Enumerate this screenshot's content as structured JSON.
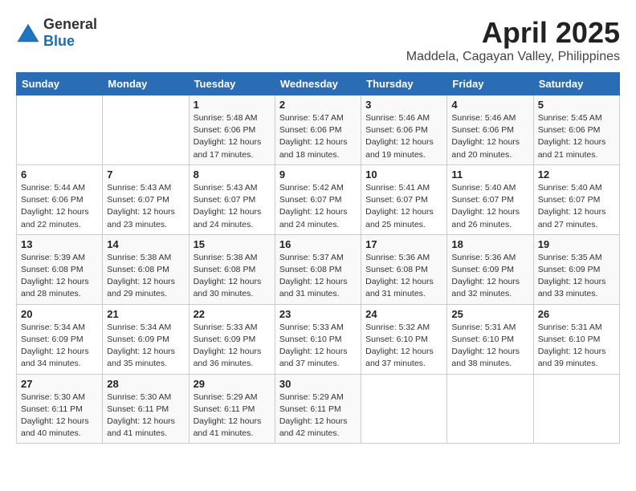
{
  "header": {
    "logo_general": "General",
    "logo_blue": "Blue",
    "month_year": "April 2025",
    "location": "Maddela, Cagayan Valley, Philippines"
  },
  "weekdays": [
    "Sunday",
    "Monday",
    "Tuesday",
    "Wednesday",
    "Thursday",
    "Friday",
    "Saturday"
  ],
  "days": [
    {
      "date": "",
      "info": ""
    },
    {
      "date": "",
      "info": ""
    },
    {
      "date": "1",
      "info": "Sunrise: 5:48 AM\nSunset: 6:06 PM\nDaylight: 12 hours and 17 minutes."
    },
    {
      "date": "2",
      "info": "Sunrise: 5:47 AM\nSunset: 6:06 PM\nDaylight: 12 hours and 18 minutes."
    },
    {
      "date": "3",
      "info": "Sunrise: 5:46 AM\nSunset: 6:06 PM\nDaylight: 12 hours and 19 minutes."
    },
    {
      "date": "4",
      "info": "Sunrise: 5:46 AM\nSunset: 6:06 PM\nDaylight: 12 hours and 20 minutes."
    },
    {
      "date": "5",
      "info": "Sunrise: 5:45 AM\nSunset: 6:06 PM\nDaylight: 12 hours and 21 minutes."
    },
    {
      "date": "6",
      "info": "Sunrise: 5:44 AM\nSunset: 6:06 PM\nDaylight: 12 hours and 22 minutes."
    },
    {
      "date": "7",
      "info": "Sunrise: 5:43 AM\nSunset: 6:07 PM\nDaylight: 12 hours and 23 minutes."
    },
    {
      "date": "8",
      "info": "Sunrise: 5:43 AM\nSunset: 6:07 PM\nDaylight: 12 hours and 24 minutes."
    },
    {
      "date": "9",
      "info": "Sunrise: 5:42 AM\nSunset: 6:07 PM\nDaylight: 12 hours and 24 minutes."
    },
    {
      "date": "10",
      "info": "Sunrise: 5:41 AM\nSunset: 6:07 PM\nDaylight: 12 hours and 25 minutes."
    },
    {
      "date": "11",
      "info": "Sunrise: 5:40 AM\nSunset: 6:07 PM\nDaylight: 12 hours and 26 minutes."
    },
    {
      "date": "12",
      "info": "Sunrise: 5:40 AM\nSunset: 6:07 PM\nDaylight: 12 hours and 27 minutes."
    },
    {
      "date": "13",
      "info": "Sunrise: 5:39 AM\nSunset: 6:08 PM\nDaylight: 12 hours and 28 minutes."
    },
    {
      "date": "14",
      "info": "Sunrise: 5:38 AM\nSunset: 6:08 PM\nDaylight: 12 hours and 29 minutes."
    },
    {
      "date": "15",
      "info": "Sunrise: 5:38 AM\nSunset: 6:08 PM\nDaylight: 12 hours and 30 minutes."
    },
    {
      "date": "16",
      "info": "Sunrise: 5:37 AM\nSunset: 6:08 PM\nDaylight: 12 hours and 31 minutes."
    },
    {
      "date": "17",
      "info": "Sunrise: 5:36 AM\nSunset: 6:08 PM\nDaylight: 12 hours and 31 minutes."
    },
    {
      "date": "18",
      "info": "Sunrise: 5:36 AM\nSunset: 6:09 PM\nDaylight: 12 hours and 32 minutes."
    },
    {
      "date": "19",
      "info": "Sunrise: 5:35 AM\nSunset: 6:09 PM\nDaylight: 12 hours and 33 minutes."
    },
    {
      "date": "20",
      "info": "Sunrise: 5:34 AM\nSunset: 6:09 PM\nDaylight: 12 hours and 34 minutes."
    },
    {
      "date": "21",
      "info": "Sunrise: 5:34 AM\nSunset: 6:09 PM\nDaylight: 12 hours and 35 minutes."
    },
    {
      "date": "22",
      "info": "Sunrise: 5:33 AM\nSunset: 6:09 PM\nDaylight: 12 hours and 36 minutes."
    },
    {
      "date": "23",
      "info": "Sunrise: 5:33 AM\nSunset: 6:10 PM\nDaylight: 12 hours and 37 minutes."
    },
    {
      "date": "24",
      "info": "Sunrise: 5:32 AM\nSunset: 6:10 PM\nDaylight: 12 hours and 37 minutes."
    },
    {
      "date": "25",
      "info": "Sunrise: 5:31 AM\nSunset: 6:10 PM\nDaylight: 12 hours and 38 minutes."
    },
    {
      "date": "26",
      "info": "Sunrise: 5:31 AM\nSunset: 6:10 PM\nDaylight: 12 hours and 39 minutes."
    },
    {
      "date": "27",
      "info": "Sunrise: 5:30 AM\nSunset: 6:11 PM\nDaylight: 12 hours and 40 minutes."
    },
    {
      "date": "28",
      "info": "Sunrise: 5:30 AM\nSunset: 6:11 PM\nDaylight: 12 hours and 41 minutes."
    },
    {
      "date": "29",
      "info": "Sunrise: 5:29 AM\nSunset: 6:11 PM\nDaylight: 12 hours and 41 minutes."
    },
    {
      "date": "30",
      "info": "Sunrise: 5:29 AM\nSunset: 6:11 PM\nDaylight: 12 hours and 42 minutes."
    },
    {
      "date": "",
      "info": ""
    },
    {
      "date": "",
      "info": ""
    },
    {
      "date": "",
      "info": ""
    },
    {
      "date": "",
      "info": ""
    }
  ]
}
